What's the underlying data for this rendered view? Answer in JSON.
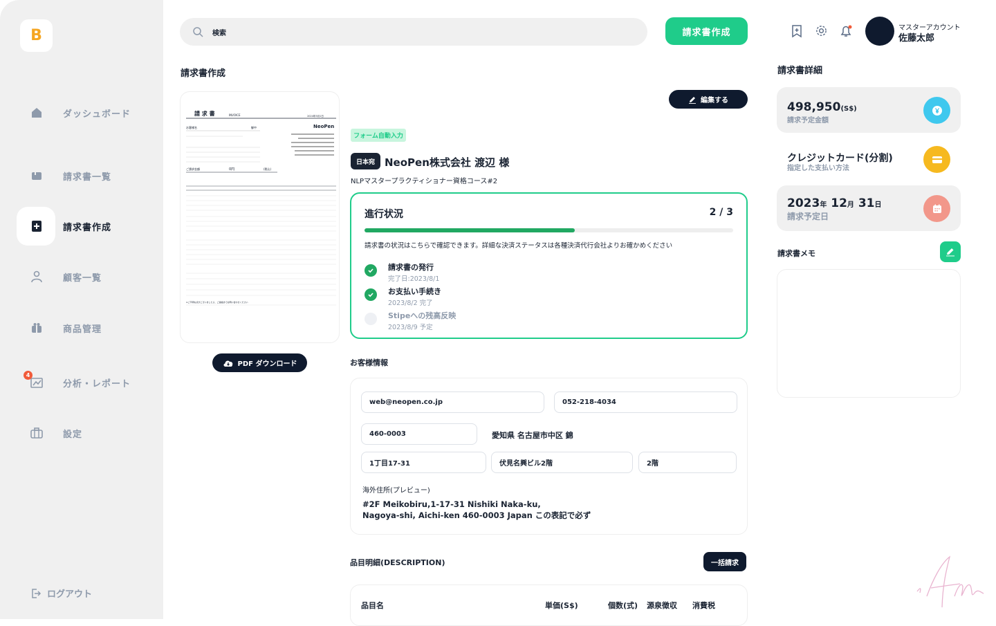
{
  "app": {
    "logo_letter": "B",
    "brand_color": "#1fcc8a",
    "accent_dark": "#0f1a2e"
  },
  "sidebar": {
    "items": [
      {
        "label": "ダッシュボード",
        "icon": "home-icon"
      },
      {
        "label": "請求書一覧",
        "icon": "folder-icon"
      },
      {
        "label": "請求書作成",
        "icon": "add-document-icon",
        "active": true
      },
      {
        "label": "顧客一覧",
        "icon": "user-icon"
      },
      {
        "label": "商品管理",
        "icon": "gift-icon"
      },
      {
        "label": "分析・レポート",
        "icon": "chart-icon",
        "badge": "4"
      },
      {
        "label": "設定",
        "icon": "briefcase-icon"
      }
    ],
    "logout": "ログアウト"
  },
  "header": {
    "search_placeholder": "検索",
    "create_button": "請求書作成",
    "account_role": "マスターアカウント",
    "account_name": "佐藤太郎"
  },
  "main": {
    "title": "請求書作成",
    "pdf_button": "PDF ダウンロード",
    "edit_button": "編集する",
    "auto_fill_tag": "フォーム自動入力",
    "destination_tag": "日本宛",
    "customer_name": "NeoPen株式会社 渡辺 様",
    "course": "NLPマスタープラクティショナー資格コース#2",
    "progress": {
      "title": "進行状況",
      "count": "2 / 3",
      "completed_fraction": 0.57,
      "description": "請求書の状況はこちらで確認できます。詳細な決済ステータスは各種決済代行会社よりお確かめください",
      "steps": [
        {
          "title": "請求書の発行",
          "sub": "完了日:2023/8/1",
          "done": true
        },
        {
          "title": "お支払い手続き",
          "sub": "2023/8/2 完了",
          "done": true
        },
        {
          "title": "Stipeへの残高反映",
          "sub": "2023/8/9 予定",
          "done": false
        }
      ]
    },
    "customer_info": {
      "title": "お客様情報",
      "email": "web@neopen.co.jp",
      "phone": "052-218-4034",
      "postal": "460-0003",
      "prefecture_city": "愛知県 名古屋市中区 錦",
      "street": "1丁目17-31",
      "building": "伏見名興ビル2階",
      "floor": "2階",
      "overseas_label": "海外住所(プレビュー)",
      "overseas_line1": "#2F Meikobiru,1-17-31 Nishiki Naka-ku,",
      "overseas_line2": "Nagoya-shi, Aichi-ken 460-0003 Japan  この表記で必ず"
    },
    "items": {
      "title": "品目明細(DESCRIPTION)",
      "bulk_button": "一括請求",
      "columns": [
        "品目名",
        "単価(S$)",
        "個数(式)",
        "源泉徴収",
        "消費税"
      ]
    }
  },
  "details": {
    "title": "請求書詳細",
    "amount": "498,950",
    "amount_unit": "(S$)",
    "amount_label": "請求予定金額",
    "payment_method": "クレジットカード(分割)",
    "payment_label": "指定した支払い方法",
    "date_year": "2023",
    "date_year_unit": "年",
    "date_month": "12",
    "date_month_unit": "月",
    "date_day": "31",
    "date_day_unit": "日",
    "date_label": "請求予定日",
    "memo_title": "請求書メモ"
  },
  "invoice_preview": {
    "title": "請 求 書",
    "subtitle": "INVOICE",
    "issue_date": "2024年5月1日",
    "company": "NeoPen",
    "recipient": "お客様名",
    "suffix": "御中",
    "total": "0円",
    "tax_note": "(税込)",
    "footer": "※ご不明な点がございましたら、ご連絡までお問い合わせください"
  }
}
